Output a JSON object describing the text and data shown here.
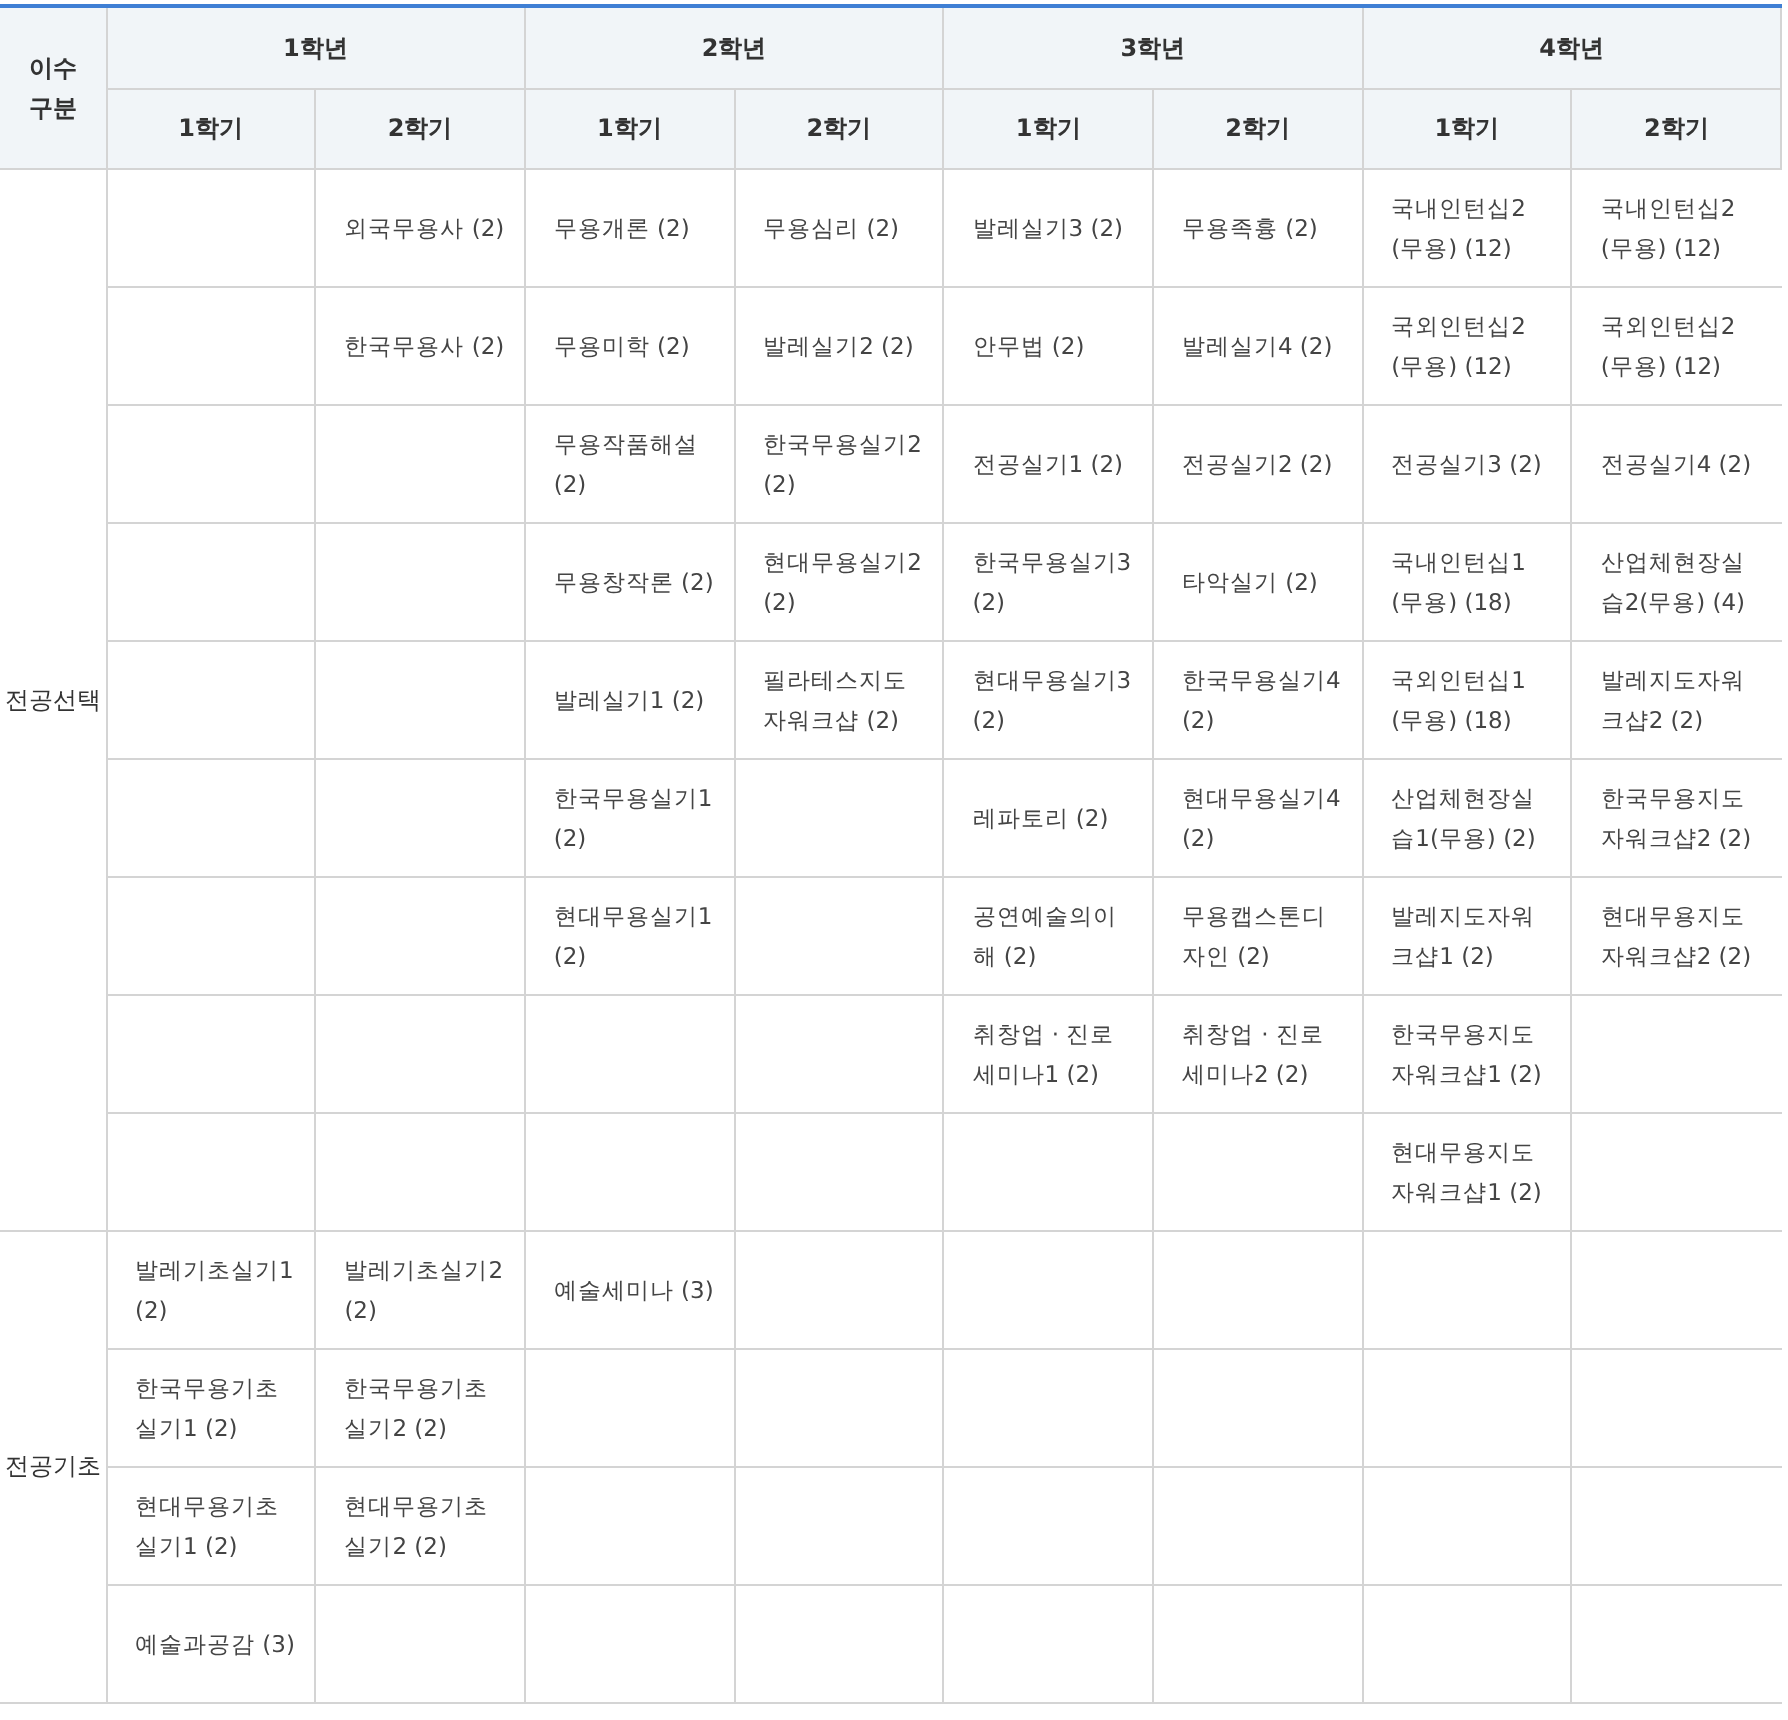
{
  "table": {
    "corner_header": "이수\n구분",
    "years": [
      {
        "label": "1학년",
        "terms": [
          "1학기",
          "2학기"
        ]
      },
      {
        "label": "2학년",
        "terms": [
          "1학기",
          "2학기"
        ]
      },
      {
        "label": "3학년",
        "terms": [
          "1학기",
          "2학기"
        ]
      },
      {
        "label": "4학년",
        "terms": [
          "1학기",
          "2학기"
        ]
      }
    ],
    "groups": [
      {
        "label": "전공선택",
        "rows": [
          [
            null,
            "외국무용사 (2)",
            "무용개론 (2)",
            "무용심리 (2)",
            "발레실기3 (2)",
            "무용족흉 (2)",
            "국내인턴십2(무용) (12)",
            "국내인턴십2(무용) (12)"
          ],
          [
            null,
            "한국무용사 (2)",
            "무용미학 (2)",
            "발레실기2 (2)",
            "안무법 (2)",
            "발레실기4 (2)",
            "국외인턴십2(무용) (12)",
            "국외인턴십2(무용) (12)"
          ],
          [
            null,
            null,
            "무용작품해설 (2)",
            "한국무용실기2 (2)",
            "전공실기1 (2)",
            "전공실기2 (2)",
            "전공실기3 (2)",
            "전공실기4 (2)"
          ],
          [
            null,
            null,
            "무용창작론 (2)",
            "현대무용실기2 (2)",
            "한국무용실기3 (2)",
            "타악실기 (2)",
            "국내인턴십1(무용) (18)",
            "산업체현장실습2(무용) (4)"
          ],
          [
            null,
            null,
            "발레실기1 (2)",
            "필라테스지도자워크샵 (2)",
            "현대무용실기3 (2)",
            "한국무용실기4 (2)",
            "국외인턴십1(무용) (18)",
            "발레지도자워크샵2 (2)"
          ],
          [
            null,
            null,
            "한국무용실기1 (2)",
            null,
            "레파토리 (2)",
            "현대무용실기4 (2)",
            "산업체현장실습1(무용) (2)",
            "한국무용지도자워크샵2 (2)"
          ],
          [
            null,
            null,
            "현대무용실기1 (2)",
            null,
            "공연예술의이해 (2)",
            "무용캡스톤디자인 (2)",
            "발레지도자워크샵1 (2)",
            "현대무용지도자워크샵2 (2)"
          ],
          [
            null,
            null,
            null,
            null,
            "취창업 · 진로세미나1 (2)",
            "취창업 · 진로세미나2 (2)",
            "한국무용지도자워크샵1 (2)",
            null
          ],
          [
            null,
            null,
            null,
            null,
            null,
            null,
            "현대무용지도자워크샵1 (2)",
            null
          ]
        ]
      },
      {
        "label": "전공기초",
        "rows": [
          [
            "발레기초실기1 (2)",
            "발레기초실기2 (2)",
            "예술세미나 (3)",
            null,
            null,
            null,
            null,
            null
          ],
          [
            "한국무용기초실기1 (2)",
            "한국무용기초실기2 (2)",
            null,
            null,
            null,
            null,
            null,
            null
          ],
          [
            "현대무용기초실기1 (2)",
            "현대무용기초실기2 (2)",
            null,
            null,
            null,
            null,
            null,
            null
          ],
          [
            "예술과공감 (3)",
            null,
            null,
            null,
            null,
            null,
            null,
            null
          ]
        ]
      }
    ]
  }
}
